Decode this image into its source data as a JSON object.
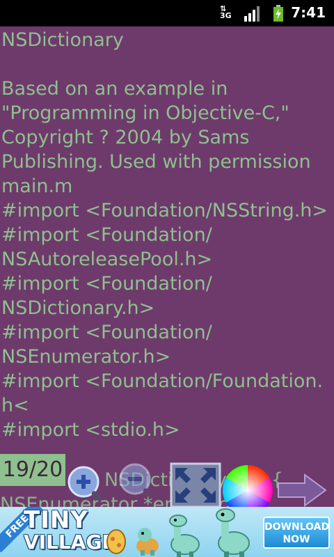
{
  "status_bar": {
    "network": "3G",
    "time": "7:41",
    "icons": [
      "3g-signal-icon",
      "signal-bars-icon",
      "battery-charging-icon"
    ]
  },
  "document": {
    "title": "NSDictionary",
    "lines": [
      "Based on an example in",
      "\"Programming in Objective-C,\"",
      "Copyright ? 2004 by Sams",
      "Publishing. Used with permission",
      "main.m",
      "#import <Foundation/NSString.h>",
      "#import <Foundation/",
      "NSAutoreleasePool.h>",
      "#import <Foundation/",
      "NSDictionary.h>",
      "#import <Foundation/",
      "NSEnumerator.h>",
      "#import <Foundation/Foundation.",
      "h<",
      "#import <stdio.h>"
    ],
    "partial_lines": [
      "NSDictionary( p ) {",
      "    NSEnumerator *enumerator"
    ]
  },
  "controls": {
    "page_counter": "19/20",
    "icons": [
      "zoom-in-icon",
      "zoom-out-icon",
      "fullscreen-icon",
      "color-wheel-icon",
      "next-page-arrow-icon"
    ]
  },
  "ad": {
    "ribbon": "FREE",
    "title_line1": "TINY",
    "title_line2": "VILLAGE",
    "button_line1": "DOWNLOAD",
    "button_line2": "NOW"
  },
  "colors": {
    "background": "#6e3a6b",
    "text": "#8fc08f",
    "status_bar": "#000000"
  }
}
